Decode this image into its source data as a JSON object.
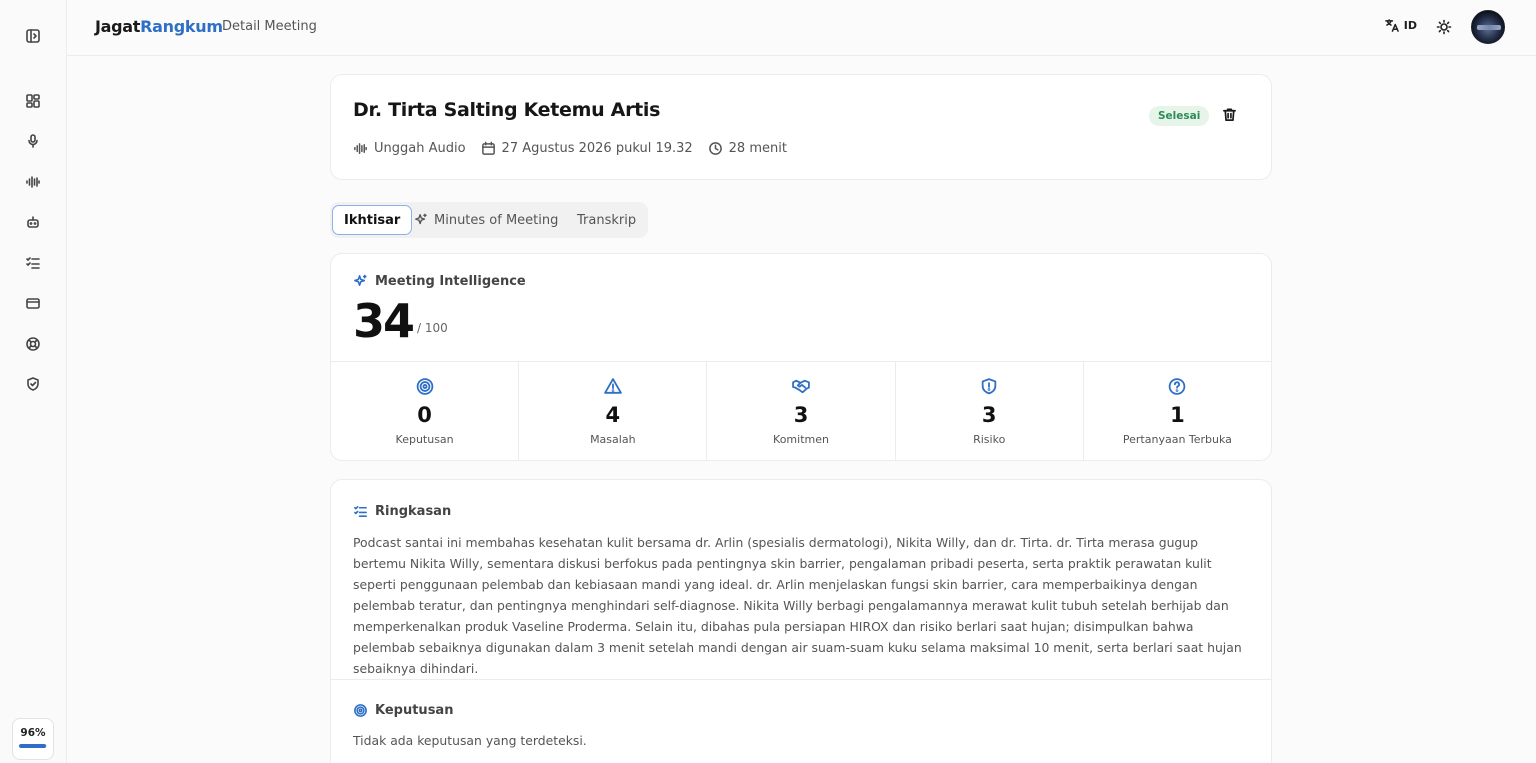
{
  "app": {
    "brand_part1": "Jagat",
    "brand_part2": "Rangkum",
    "breadcrumb": "Detail Meeting",
    "language": "ID",
    "accent_color": "#2f6fc6"
  },
  "sidebar": {
    "items": [
      {
        "icon": "sidebar-toggle-icon"
      },
      {
        "icon": "dashboard-icon"
      },
      {
        "icon": "microphone-icon"
      },
      {
        "icon": "audio-wave-icon"
      },
      {
        "icon": "bot-icon"
      },
      {
        "icon": "task-list-icon"
      },
      {
        "icon": "credit-card-icon"
      },
      {
        "icon": "help-lifebuoy-icon"
      },
      {
        "icon": "shield-check-icon"
      }
    ],
    "progress_label": "96%",
    "progress_value": 0.96
  },
  "meeting": {
    "title": "Dr. Tirta Salting Ketemu Artis",
    "source": "Unggah Audio",
    "date": "27 Agustus 2026 pukul 19.32",
    "duration": "28 menit",
    "status": "Selesai",
    "status_color": "#2e8b57"
  },
  "tabs": [
    {
      "label": "Ikhtisar",
      "active": true
    },
    {
      "label": "Minutes of Meeting",
      "active": false
    },
    {
      "label": "Transkrip",
      "active": false
    }
  ],
  "intelligence": {
    "heading": "Meeting Intelligence",
    "score": "34",
    "score_max": "/ 100",
    "stats": [
      {
        "value": "0",
        "label": "Keputusan",
        "icon": "target-icon"
      },
      {
        "value": "4",
        "label": "Masalah",
        "icon": "warning-icon"
      },
      {
        "value": "3",
        "label": "Komitmen",
        "icon": "handshake-icon"
      },
      {
        "value": "3",
        "label": "Risiko",
        "icon": "shield-alert-icon"
      },
      {
        "value": "1",
        "label": "Pertanyaan Terbuka",
        "icon": "question-icon"
      }
    ]
  },
  "summary": {
    "heading": "Ringkasan",
    "text": "Podcast santai ini membahas kesehatan kulit bersama dr. Arlin (spesialis dermatologi), Nikita Willy, dan dr. Tirta. dr. Tirta merasa gugup bertemu Nikita Willy, sementara diskusi berfokus pada pentingnya skin barrier, pengalaman pribadi peserta, serta praktik perawatan kulit seperti penggunaan pelembab dan kebiasaan mandi yang ideal. dr. Arlin menjelaskan fungsi skin barrier, cara memperbaikinya dengan pelembab teratur, dan pentingnya menghindari self-diagnose. Nikita Willy berbagi pengalamannya merawat kulit tubuh setelah berhijab dan memperkenalkan produk Vaseline Proderma. Selain itu, dibahas pula persiapan HIROX dan risiko berlari saat hujan; disimpulkan bahwa pelembab sebaiknya digunakan dalam 3 menit setelah mandi dengan air suam-suam kuku selama maksimal 10 menit, serta berlari saat hujan sebaiknya dihindari."
  },
  "decisions": {
    "heading": "Keputusan",
    "empty_text": "Tidak ada keputusan yang terdeteksi."
  }
}
